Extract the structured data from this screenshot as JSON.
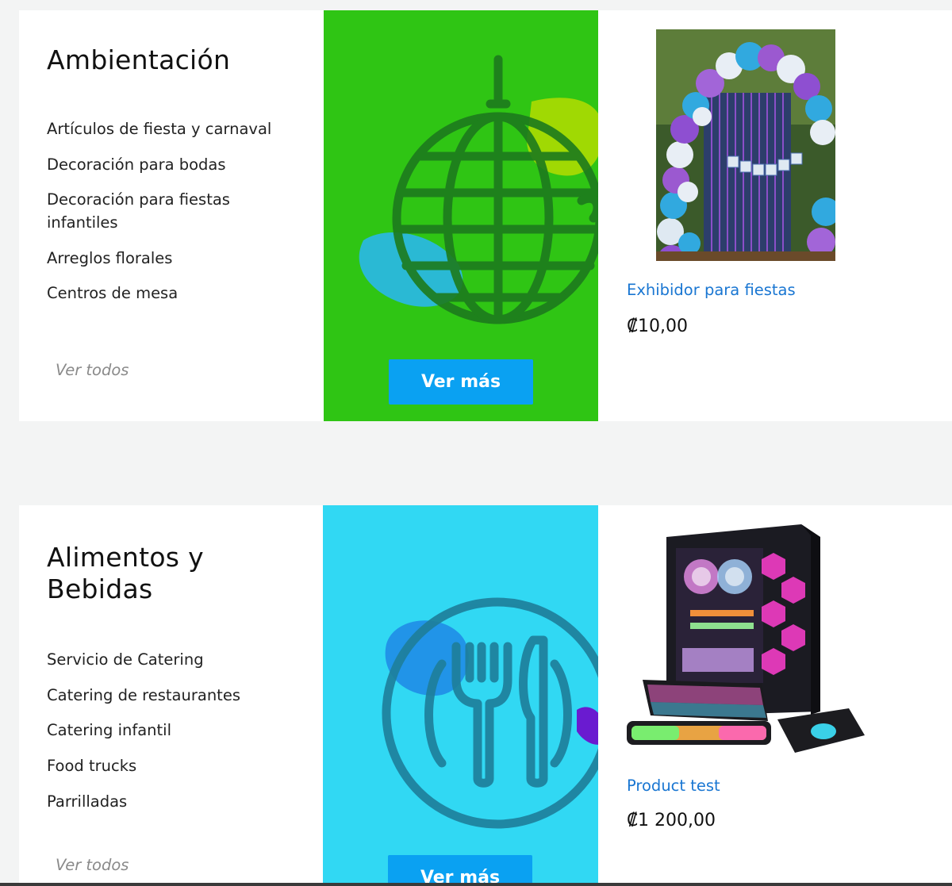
{
  "sections": [
    {
      "title": "Ambientación",
      "links": [
        "Artículos de fiesta y carnaval",
        "Decoración para bodas",
        "Decoración para fiestas infantiles",
        "Arreglos florales",
        "Centros de mesa"
      ],
      "view_all": "Ver todos",
      "banner": {
        "icon": "disco-ball-icon",
        "bg_color": "#2fc514",
        "button_label": "Ver más"
      },
      "product": {
        "name": "Exhibidor para fiestas",
        "price": "₡10,00",
        "image": "balloon-arch-photo"
      }
    },
    {
      "title": "Alimentos y Bebidas",
      "links": [
        "Servicio de Catering",
        "Catering de restaurantes",
        "Catering infantil",
        "Food trucks",
        "Parrilladas"
      ],
      "view_all": "Ver todos",
      "banner": {
        "icon": "cutlery-plate-icon",
        "bg_color": "#31d8f3",
        "button_label": "Ver más"
      },
      "product": {
        "name": "Product test",
        "price": "₡1 200,00",
        "image": "gaming-pc-photo"
      }
    }
  ],
  "colors": {
    "link_blue": "#1976d2",
    "button_blue": "#0aa1f2",
    "page_bg": "#f3f4f4"
  }
}
